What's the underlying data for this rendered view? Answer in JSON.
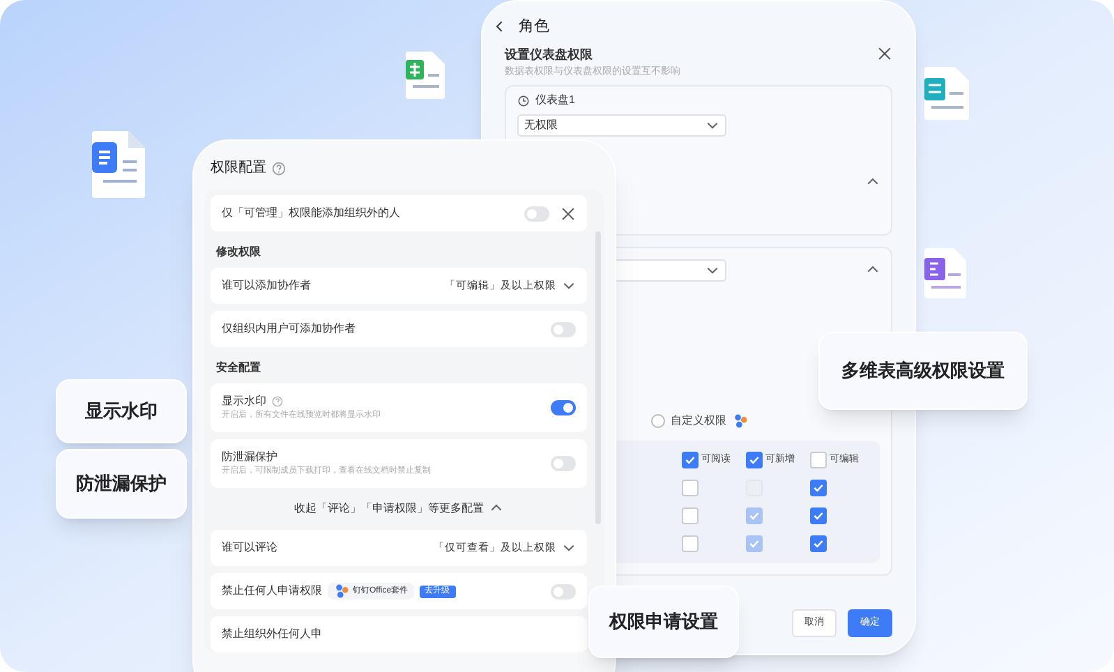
{
  "back_panel": {
    "back_label": "角色",
    "title": "设置仪表盘权限",
    "subtitle": "数据表权限与仪表盘权限的设置互不影响",
    "dashboard": {
      "name": "仪表盘1",
      "value": "无权限",
      "expanded": true
    },
    "section_2": {
      "expanded": true
    },
    "radio": {
      "label": "自定义权限",
      "selected": false
    },
    "columns": [
      {
        "label": "可阅读",
        "checked": true
      },
      {
        "label": "可新增",
        "checked": true
      },
      {
        "label": "可编辑",
        "checked": false
      }
    ],
    "rows": [
      {
        "cells": [
          {
            "checked": false,
            "disabled": false
          },
          {
            "checked": false,
            "disabled": true
          },
          {
            "checked": true,
            "disabled": false
          }
        ]
      },
      {
        "cells": [
          {
            "checked": false,
            "disabled": false
          },
          {
            "checked": true,
            "disabled": true
          },
          {
            "checked": true,
            "disabled": false
          }
        ]
      },
      {
        "cells": [
          {
            "checked": false,
            "disabled": false
          },
          {
            "checked": true,
            "disabled": true
          },
          {
            "checked": true,
            "disabled": false
          }
        ]
      }
    ],
    "buttons": [
      {
        "label": "取消",
        "kind": "secondary"
      },
      {
        "label": "确定",
        "kind": "primary"
      }
    ]
  },
  "front_panel": {
    "title": "权限配置",
    "items": [
      {
        "kind": "row",
        "label": "仅「可管理」权限能添加组织外的人",
        "on": false
      },
      {
        "kind": "heading",
        "label": "修改权限"
      },
      {
        "kind": "select",
        "label": "谁可以添加协作者",
        "value": "「可编辑」及以上权限"
      },
      {
        "kind": "row",
        "label": "仅组织内用户可添加协作者",
        "on": false
      },
      {
        "kind": "heading",
        "label": "安全配置"
      },
      {
        "kind": "row",
        "label": "显示水印",
        "help": true,
        "description": "开启后，所有文件在线预览时都将显示水印",
        "on": true
      },
      {
        "kind": "row",
        "label": "防泄漏保护",
        "description": "开启后，可限制成员下载打印，查看在线文档时禁止复制",
        "on": false
      },
      {
        "kind": "collapse",
        "label": "收起「评论」「申请权限」等更多配置",
        "expanded": true
      },
      {
        "kind": "select",
        "label": "谁可以评论",
        "value": "「仅可查看」及以上权限"
      },
      {
        "kind": "row",
        "label": "禁止任何人申请权限",
        "tag": "钉钉Office套件",
        "upgrade": "去升级",
        "on": false
      },
      {
        "kind": "row",
        "label": "禁止组织外任何人申"
      }
    ]
  },
  "callouts": [
    "显示水印",
    "防泄漏保护",
    "多维表高级权限设置",
    "权限申请设置"
  ]
}
